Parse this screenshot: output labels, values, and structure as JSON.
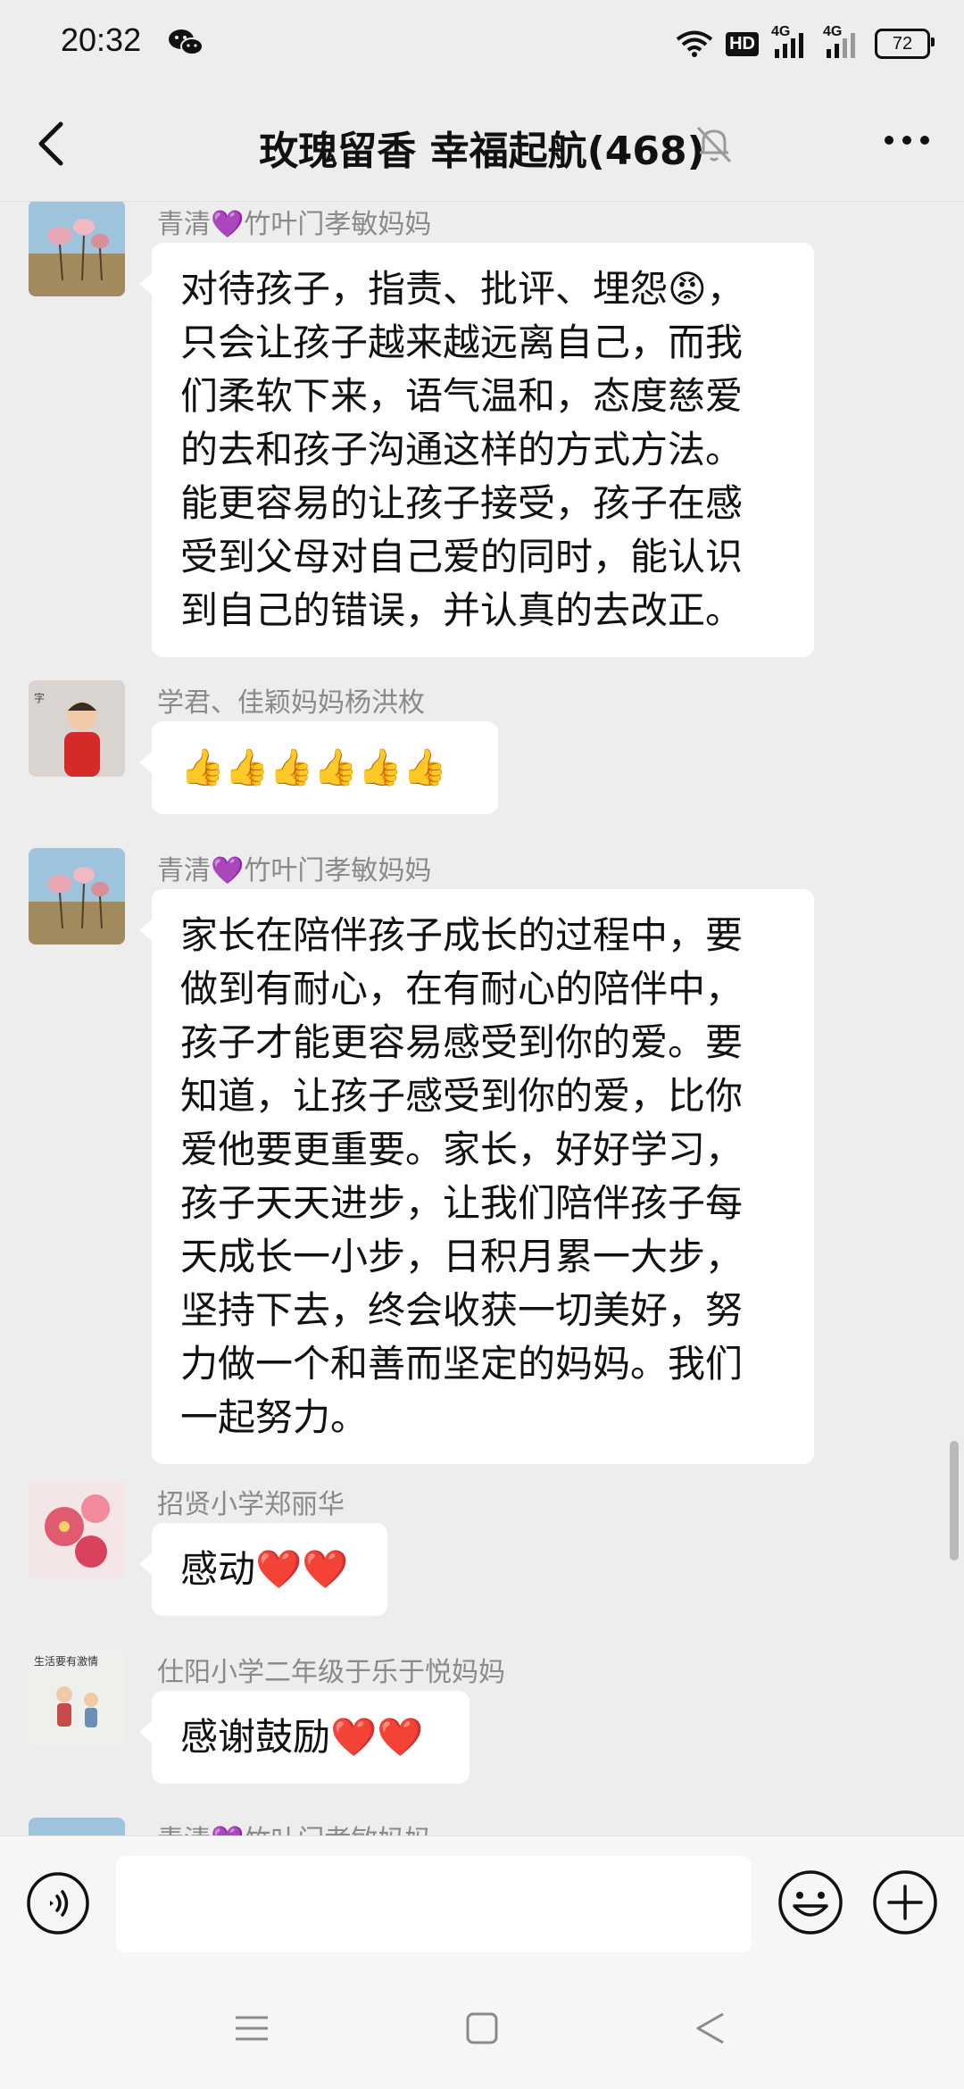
{
  "status_bar": {
    "time": "20:32",
    "hd_label": "HD",
    "network_1": "4G",
    "network_2": "4G",
    "battery": "72"
  },
  "header": {
    "title": "玫瑰留香  幸福起航(468)"
  },
  "messages": [
    {
      "sender": "青清💜竹叶门孝敏妈妈",
      "lines": [
        "对待孩子，指责、批评、埋怨😡，",
        "只会让孩子越来越远离自己，而我",
        "们柔软下来，语气温和，态度慈爱",
        "的去和孩子沟通这样的方式方法。",
        "能更容易的让孩子接受，孩子在感",
        "受到父母对自己爱的同时，能认识",
        "到自己的错误，并认真的去改正。"
      ]
    },
    {
      "sender": "学君、佳颖妈妈杨洪枚",
      "text": "👍👍👍👍👍👍"
    },
    {
      "sender": "青清💜竹叶门孝敏妈妈",
      "lines": [
        "家长在陪伴孩子成长的过程中，要",
        "做到有耐心，在有耐心的陪伴中，",
        "孩子才能更容易感受到你的爱。要",
        "知道，让孩子感受到你的爱，比你",
        "爱他要更重要。家长，好好学习，",
        "孩子天天进步，让我们陪伴孩子每",
        "天成长一小步，日积月累一大步，",
        "坚持下去，终会收获一切美好，努",
        "力做一个和善而坚定的妈妈。我们",
        "一起努力。"
      ]
    },
    {
      "sender": "招贤小学郑丽华",
      "text": "感动❤️❤️"
    },
    {
      "sender": "仕阳小学二年级于乐于悦妈妈",
      "avatar_text": "生活要有激情",
      "text": "感谢鼓励❤️❤️"
    },
    {
      "sender": "青清💜竹叶门孝敏妈妈"
    }
  ],
  "colors": {
    "background": "#ededed",
    "bubble": "#ffffff",
    "sender": "#8a8a8a"
  },
  "icons": {
    "back": "chevron-left-icon",
    "mute": "bell-off-icon",
    "more": "more-dots-icon",
    "voice": "voice-icon",
    "emoji": "smile-icon",
    "plus": "plus-icon"
  }
}
